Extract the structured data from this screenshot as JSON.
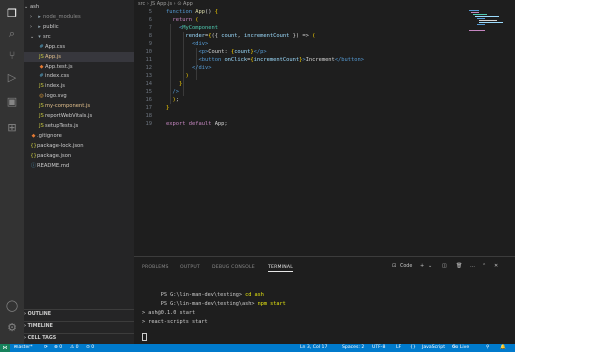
{
  "activity": {
    "explorer": "Explorer",
    "search": "Search",
    "scm": "Source Control",
    "run": "Run and Debug",
    "remote": "Remote Explorer",
    "extensions": "Extensions",
    "account": "Accounts",
    "manage": "Manage"
  },
  "sidebar": {
    "root_label": "ash",
    "items": [
      {
        "label": "node_modules",
        "chevron": "›",
        "icon": "▸"
      },
      {
        "label": "public",
        "chevron": "›",
        "icon": "▸"
      },
      {
        "label": "src",
        "chevron": "⌄",
        "icon": "▾"
      },
      {
        "label": "App.css",
        "icon": "#"
      },
      {
        "label": "App.js",
        "icon": "JS",
        "badge": "M"
      },
      {
        "label": "App.test.js",
        "icon": "◆"
      },
      {
        "label": "index.css",
        "icon": "#"
      },
      {
        "label": "index.js",
        "icon": "JS"
      },
      {
        "label": "logo.svg",
        "icon": "◎"
      },
      {
        "label": "my-component.js",
        "icon": "JS"
      },
      {
        "label": "reportWebVitals.js",
        "icon": "JS"
      },
      {
        "label": "setupTests.js",
        "icon": "JS"
      },
      {
        "label": ".gitignore",
        "icon": "◆"
      },
      {
        "label": "package-lock.json",
        "icon": "{}"
      },
      {
        "label": "package.json",
        "icon": "{}"
      },
      {
        "label": "README.md",
        "icon": "ⓘ"
      }
    ],
    "sections": [
      "OUTLINE",
      "TIMELINE",
      "CELL TAGS"
    ]
  },
  "editor": {
    "breadcrumb": "src › JS App.js › ⊙ App",
    "lines": [
      {
        "n": "5",
        "segs": [
          [
            "kw",
            "function "
          ],
          [
            "fn",
            "App"
          ],
          [
            "txt",
            "() "
          ],
          [
            "brk",
            "{"
          ]
        ]
      },
      {
        "n": "6",
        "segs": [
          [
            "txt",
            "  "
          ],
          [
            "kw2",
            "return "
          ],
          [
            "brk",
            "("
          ]
        ]
      },
      {
        "n": "7",
        "segs": [
          [
            "txt",
            "    "
          ],
          [
            "tag2",
            "<"
          ],
          [
            "tag",
            "MyComponent"
          ]
        ]
      },
      {
        "n": "8",
        "segs": [
          [
            "txt",
            "      "
          ],
          [
            "var",
            "render"
          ],
          [
            "txt",
            "="
          ],
          [
            "brk",
            "{"
          ],
          [
            "txt",
            "({ "
          ],
          [
            "var",
            "count"
          ],
          [
            "txt",
            ", "
          ],
          [
            "var",
            "incrementCount"
          ],
          [
            "txt",
            " }) => "
          ],
          [
            "brk",
            "("
          ]
        ]
      },
      {
        "n": "9",
        "segs": [
          [
            "txt",
            "        "
          ],
          [
            "tag2",
            "<div>"
          ]
        ]
      },
      {
        "n": "10",
        "segs": [
          [
            "txt",
            "          "
          ],
          [
            "tag2",
            "<p>"
          ],
          [
            "txt",
            "Count: "
          ],
          [
            "brk",
            "{"
          ],
          [
            "var",
            "count"
          ],
          [
            "brk",
            "}"
          ],
          [
            "tag2",
            "</p>"
          ]
        ]
      },
      {
        "n": "11",
        "segs": [
          [
            "txt",
            "          "
          ],
          [
            "tag2",
            "<button "
          ],
          [
            "var",
            "onClick"
          ],
          [
            "txt",
            "="
          ],
          [
            "brk",
            "{"
          ],
          [
            "var",
            "incrementCount"
          ],
          [
            "brk",
            "}"
          ],
          [
            "tag2",
            ">"
          ],
          [
            "txt",
            "Increment"
          ],
          [
            "tag2",
            "</button>"
          ]
        ]
      },
      {
        "n": "12",
        "segs": [
          [
            "txt",
            "        "
          ],
          [
            "tag2",
            "</div>"
          ]
        ]
      },
      {
        "n": "13",
        "segs": [
          [
            "txt",
            "      "
          ],
          [
            "brk",
            ")"
          ]
        ]
      },
      {
        "n": "14",
        "segs": [
          [
            "txt",
            "    "
          ],
          [
            "brk",
            "}"
          ]
        ]
      },
      {
        "n": "15",
        "segs": [
          [
            "txt",
            "  "
          ],
          [
            "tag2",
            "/>"
          ]
        ]
      },
      {
        "n": "16",
        "segs": [
          [
            "txt",
            "  "
          ],
          [
            "brk",
            ")"
          ],
          [
            "txt",
            ";"
          ]
        ]
      },
      {
        "n": "17",
        "segs": [
          [
            "brk",
            "}"
          ]
        ]
      },
      {
        "n": "18",
        "segs": []
      },
      {
        "n": "19",
        "segs": [
          [
            "kw2",
            "export default "
          ],
          [
            "txt",
            "App;"
          ]
        ]
      }
    ]
  },
  "panel": {
    "tabs": [
      "PROBLEMS",
      "OUTPUT",
      "DEBUG CONSOLE",
      "TERMINAL"
    ],
    "terminal_name": "Code",
    "terminal": {
      "l1_prompt": "PS G:\\lin-man-dev\\testing> ",
      "l1_cmd": "cd ash",
      "l2_prompt": "PS G:\\lin-man-dev\\testing\\ash> ",
      "l2_cmd": "npm start",
      "l3": "> ash@0.1.0 start",
      "l4": "> react-scripts start"
    }
  },
  "statusbar": {
    "branch": "master*",
    "sync": "⟳",
    "errors": "⊗ 0",
    "warnings": "⚠ 0",
    "ports": "⊙ 0",
    "position": "Ln 3, Col 17",
    "spaces": "Spaces: 2",
    "encoding": "UTF-8",
    "eol": "LF",
    "language": "JavaScript",
    "golive": "Go Live"
  }
}
